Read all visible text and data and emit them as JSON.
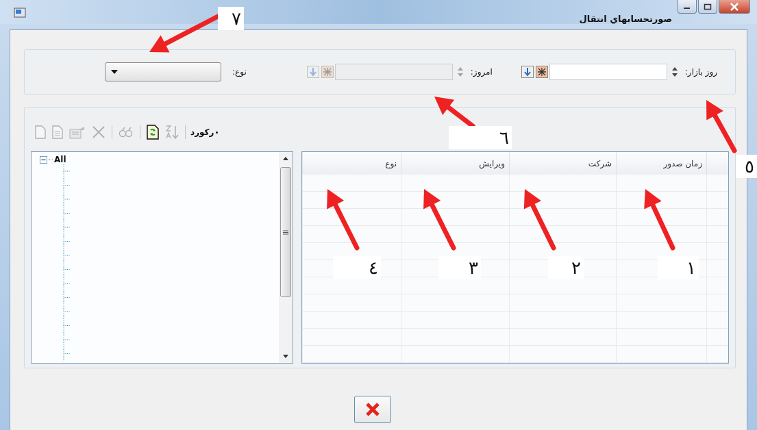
{
  "window": {
    "title": "صورتحسابهاي انتقال"
  },
  "filters": {
    "market_day": {
      "label": "روز بازار:",
      "disabled": false
    },
    "today": {
      "label": "امروز:",
      "disabled": true
    },
    "type": {
      "label": "نوع:"
    }
  },
  "toolbar": {
    "label": "رکورد",
    "buttons": [
      {
        "kind": "new",
        "disabled": true
      },
      {
        "kind": "document",
        "disabled": true
      },
      {
        "kind": "properties",
        "disabled": true
      },
      {
        "kind": "delete",
        "disabled": true
      },
      {
        "kind": "find",
        "disabled": true
      },
      {
        "kind": "refresh",
        "disabled": false
      },
      {
        "kind": "sort",
        "disabled": true
      }
    ]
  },
  "tree": {
    "label": "All",
    "expanded": true
  },
  "table": {
    "columns": [
      "زمان صدور",
      "شرکت",
      "ويرايش",
      "نوع"
    ]
  },
  "annotations": [
    {
      "label": "٧"
    },
    {
      "label": "٦"
    },
    {
      "label": "٥"
    },
    {
      "label": "١"
    },
    {
      "label": "٢"
    },
    {
      "label": "٣"
    },
    {
      "label": "٤"
    }
  ]
}
